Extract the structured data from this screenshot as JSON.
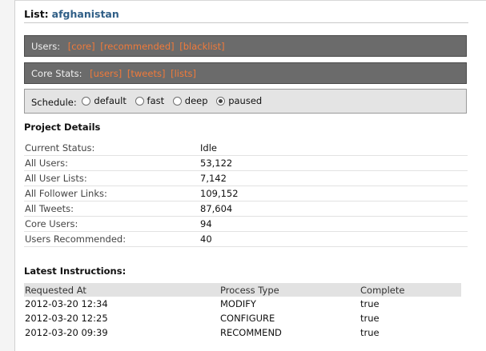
{
  "list": {
    "label": "List:",
    "name": "afghanistan"
  },
  "users_bar": {
    "label": "Users:",
    "links": [
      "[core]",
      "[recommended]",
      "[blacklist]"
    ]
  },
  "core_stats_bar": {
    "label": "Core Stats:",
    "links": [
      "[users]",
      "[tweets]",
      "[lists]"
    ]
  },
  "schedule": {
    "label": "Schedule:",
    "options": [
      "default",
      "fast",
      "deep",
      "paused"
    ],
    "selected": "paused"
  },
  "project_details": {
    "title": "Project Details",
    "rows": [
      {
        "key": "Current Status:",
        "value": "Idle"
      },
      {
        "key": "All Users:",
        "value": "53,122"
      },
      {
        "key": "All User Lists:",
        "value": "7,142"
      },
      {
        "key": "All Follower Links:",
        "value": "109,152"
      },
      {
        "key": "All Tweets:",
        "value": "87,604"
      },
      {
        "key": "Core Users:",
        "value": "94"
      },
      {
        "key": "Users Recommended:",
        "value": "40"
      }
    ]
  },
  "latest_instructions": {
    "title": "Latest Instructions:",
    "headers": [
      "Requested At",
      "Process Type",
      "Complete"
    ],
    "rows": [
      [
        "2012-03-20 12:34",
        "MODIFY",
        "true"
      ],
      [
        "2012-03-20 12:25",
        "CONFIGURE",
        "true"
      ],
      [
        "2012-03-20 09:39",
        "RECOMMEND",
        "true"
      ]
    ]
  }
}
